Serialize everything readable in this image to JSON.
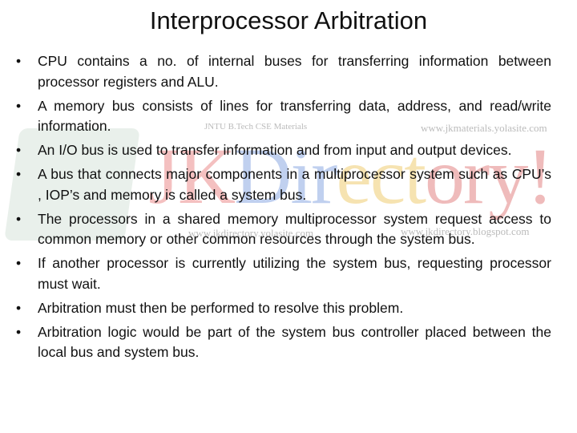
{
  "slide": {
    "title": "Interprocessor Arbitration",
    "bullet_icon": "bullet-dot",
    "bullets": [
      "CPU contains a no. of internal buses for transferring information between processor registers and ALU.",
      "A memory bus consists of lines for transferring data, address, and read/write information.",
      "An I/O bus is used to transfer information and from input and output devices.",
      "A bus that connects major components in a multiprocessor system such as CPU’s , IOP’s and memory is called a system bus.",
      "The processors in a shared memory multiprocessor system request access to common memory or other common resources through the system bus.",
      "If another processor is currently utilizing the system bus, requesting processor must wait.",
      "Arbitration must then be performed to resolve this problem.",
      "Arbitration logic would be part of the system bus controller placed between the local bus and system bus."
    ]
  },
  "watermark": {
    "brand": [
      "JK",
      "Dir",
      "ect",
      "ory!"
    ],
    "tagline": "JNTU B.Tech CSE Materials",
    "urls": [
      "www.jkmaterials.yolasite.com",
      "www.jkdirectory.yolasite.com",
      "www.jkdirectory.blogspot.com"
    ]
  }
}
